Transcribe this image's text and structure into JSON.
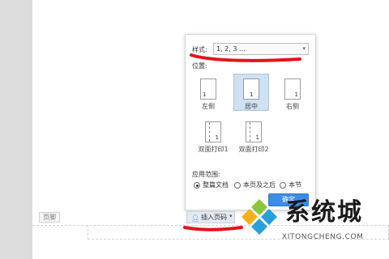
{
  "document": {
    "footer_tag": "页脚"
  },
  "panel": {
    "style_label": "样式:",
    "style_value": "1, 2, 3 ...",
    "position_label": "位置:",
    "positions": [
      {
        "label": "左侧",
        "number": "1",
        "selected": false
      },
      {
        "label": "居中",
        "number": "1",
        "selected": true
      },
      {
        "label": "右侧",
        "number": "1",
        "selected": false
      },
      {
        "label": "双面打印1",
        "number": "1",
        "selected": false
      },
      {
        "label": "双面打印2",
        "number": "1",
        "selected": false
      }
    ],
    "scope_label": "应用范围:",
    "scope_options": [
      {
        "label": "整篇文档",
        "selected": true
      },
      {
        "label": "本页及之后",
        "selected": false
      },
      {
        "label": "本节",
        "selected": false
      }
    ],
    "ok_label": "确定"
  },
  "toolbar": {
    "insert_page_number_label": "插入页码",
    "insert_icon": "person-icon"
  },
  "watermark": {
    "brand": "系统城",
    "site": "XITONGCHENG.COM"
  },
  "colors": {
    "accent": "#3f8ce4",
    "selected_tile": "#cfe0f2",
    "annotation_red": "#e0141e"
  }
}
